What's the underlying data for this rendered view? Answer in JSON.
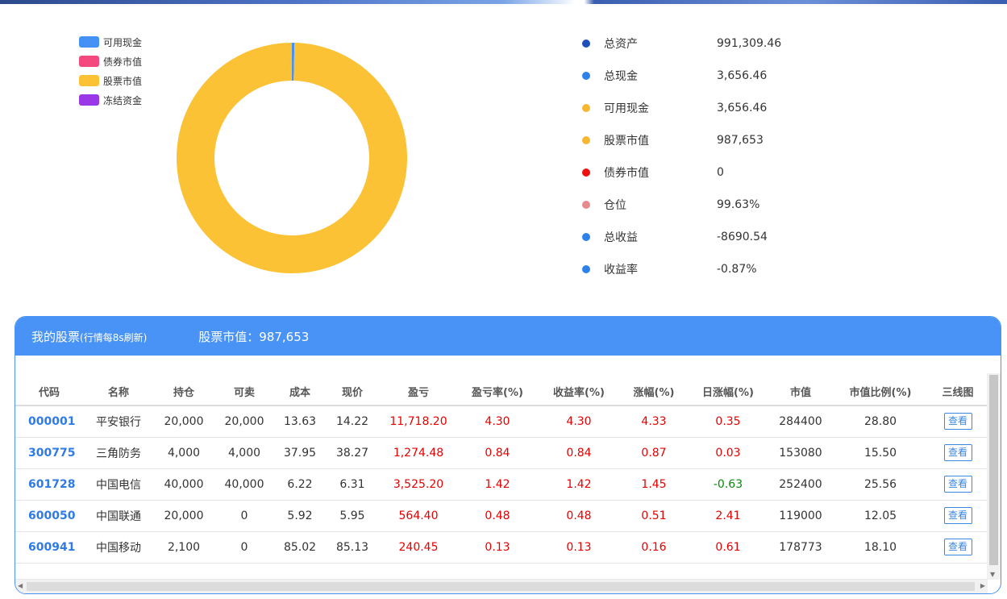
{
  "legend": [
    {
      "label": "可用现金",
      "color": "#4592f7"
    },
    {
      "label": "债券市值",
      "color": "#f5487f"
    },
    {
      "label": "股票市值",
      "color": "#fcc235"
    },
    {
      "label": "冻结资金",
      "color": "#9a37e7"
    }
  ],
  "chart_data": {
    "type": "pie",
    "variant": "donut",
    "categories": [
      "可用现金",
      "债券市值",
      "股票市值",
      "冻结资金"
    ],
    "values": [
      3656.46,
      0,
      987653,
      0
    ],
    "colors": [
      "#4592f7",
      "#f5487f",
      "#fcc235",
      "#9a37e7"
    ],
    "legend_position": "top-left"
  },
  "summary": [
    {
      "label": "总资产",
      "value": "991,309.46",
      "dot": "#1f4fb8"
    },
    {
      "label": "总现金",
      "value": "3,656.46",
      "dot": "#2c82e8"
    },
    {
      "label": "可用现金",
      "value": "3,656.46",
      "dot": "#f7b731"
    },
    {
      "label": "股票市值",
      "value": "987,653",
      "dot": "#f7b731"
    },
    {
      "label": "债券市值",
      "value": "0",
      "dot": "#ef1010"
    },
    {
      "label": "仓位",
      "value": "99.63%",
      "dot": "#e68a8e"
    },
    {
      "label": "总收益",
      "value": "-8690.54",
      "dot": "#2c82e8"
    },
    {
      "label": "收益率",
      "value": "-0.87%",
      "dot": "#2c82e8"
    }
  ],
  "panel": {
    "title": "我的股票",
    "subtitle": "(行情每8s刷新)",
    "market_value_text": "股票市值：987,653"
  },
  "table": {
    "headers": [
      "代码",
      "名称",
      "持仓",
      "可卖",
      "成本",
      "现价",
      "盈亏",
      "盈亏率(%)",
      "收益率(%)",
      "涨幅(%)",
      "日涨幅(%)",
      "市值",
      "市值比例(%)",
      "三线图"
    ],
    "view_label": "查看",
    "rows": [
      {
        "code": "000001",
        "name": "平安银行",
        "hold": "20,000",
        "sellable": "20,000",
        "cost": "13.63",
        "price": "14.22",
        "pnl": "11,718.20",
        "pnl_rate": "4.30",
        "return_rate": "4.30",
        "change": "4.33",
        "day_change": "0.35",
        "day_dir": "up",
        "mv": "284400",
        "mv_ratio": "28.80"
      },
      {
        "code": "300775",
        "name": "三角防务",
        "hold": "4,000",
        "sellable": "4,000",
        "cost": "37.95",
        "price": "38.27",
        "pnl": "1,274.48",
        "pnl_rate": "0.84",
        "return_rate": "0.84",
        "change": "0.87",
        "day_change": "0.03",
        "day_dir": "up",
        "mv": "153080",
        "mv_ratio": "15.50"
      },
      {
        "code": "601728",
        "name": "中国电信",
        "hold": "40,000",
        "sellable": "40,000",
        "cost": "6.22",
        "price": "6.31",
        "pnl": "3,525.20",
        "pnl_rate": "1.42",
        "return_rate": "1.42",
        "change": "1.45",
        "day_change": "-0.63",
        "day_dir": "down",
        "mv": "252400",
        "mv_ratio": "25.56"
      },
      {
        "code": "600050",
        "name": "中国联通",
        "hold": "20,000",
        "sellable": "0",
        "cost": "5.92",
        "price": "5.95",
        "pnl": "564.40",
        "pnl_rate": "0.48",
        "return_rate": "0.48",
        "change": "0.51",
        "day_change": "2.41",
        "day_dir": "up",
        "mv": "119000",
        "mv_ratio": "12.05"
      },
      {
        "code": "600941",
        "name": "中国移动",
        "hold": "2,100",
        "sellable": "0",
        "cost": "85.02",
        "price": "85.13",
        "pnl": "240.45",
        "pnl_rate": "0.13",
        "return_rate": "0.13",
        "change": "0.16",
        "day_change": "0.61",
        "day_dir": "up",
        "mv": "178773",
        "mv_ratio": "18.10"
      }
    ]
  }
}
